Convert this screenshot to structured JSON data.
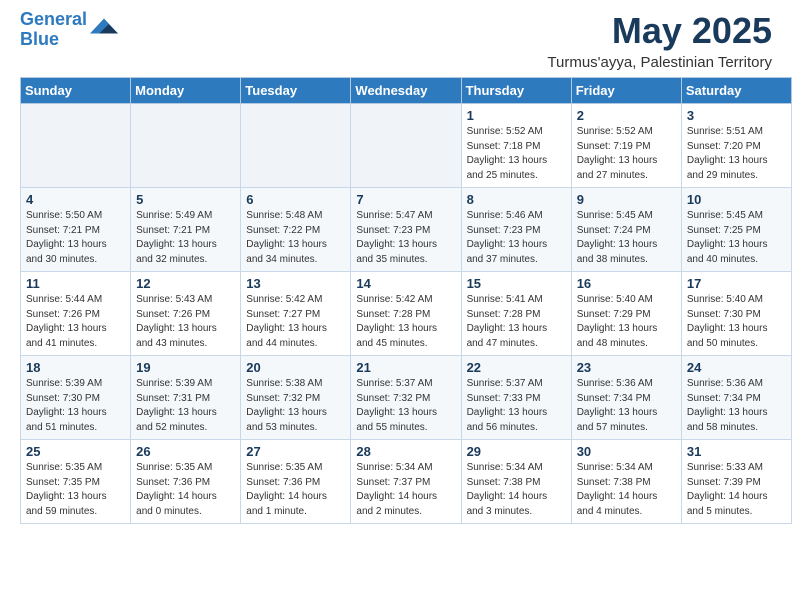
{
  "header": {
    "logo_line1": "General",
    "logo_line2": "Blue",
    "month_title": "May 2025",
    "location": "Turmus'ayya, Palestinian Territory"
  },
  "calendar": {
    "days_of_week": [
      "Sunday",
      "Monday",
      "Tuesday",
      "Wednesday",
      "Thursday",
      "Friday",
      "Saturday"
    ],
    "weeks": [
      [
        {
          "day": "",
          "info": ""
        },
        {
          "day": "",
          "info": ""
        },
        {
          "day": "",
          "info": ""
        },
        {
          "day": "",
          "info": ""
        },
        {
          "day": "1",
          "info": "Sunrise: 5:52 AM\nSunset: 7:18 PM\nDaylight: 13 hours\nand 25 minutes."
        },
        {
          "day": "2",
          "info": "Sunrise: 5:52 AM\nSunset: 7:19 PM\nDaylight: 13 hours\nand 27 minutes."
        },
        {
          "day": "3",
          "info": "Sunrise: 5:51 AM\nSunset: 7:20 PM\nDaylight: 13 hours\nand 29 minutes."
        }
      ],
      [
        {
          "day": "4",
          "info": "Sunrise: 5:50 AM\nSunset: 7:21 PM\nDaylight: 13 hours\nand 30 minutes."
        },
        {
          "day": "5",
          "info": "Sunrise: 5:49 AM\nSunset: 7:21 PM\nDaylight: 13 hours\nand 32 minutes."
        },
        {
          "day": "6",
          "info": "Sunrise: 5:48 AM\nSunset: 7:22 PM\nDaylight: 13 hours\nand 34 minutes."
        },
        {
          "day": "7",
          "info": "Sunrise: 5:47 AM\nSunset: 7:23 PM\nDaylight: 13 hours\nand 35 minutes."
        },
        {
          "day": "8",
          "info": "Sunrise: 5:46 AM\nSunset: 7:23 PM\nDaylight: 13 hours\nand 37 minutes."
        },
        {
          "day": "9",
          "info": "Sunrise: 5:45 AM\nSunset: 7:24 PM\nDaylight: 13 hours\nand 38 minutes."
        },
        {
          "day": "10",
          "info": "Sunrise: 5:45 AM\nSunset: 7:25 PM\nDaylight: 13 hours\nand 40 minutes."
        }
      ],
      [
        {
          "day": "11",
          "info": "Sunrise: 5:44 AM\nSunset: 7:26 PM\nDaylight: 13 hours\nand 41 minutes."
        },
        {
          "day": "12",
          "info": "Sunrise: 5:43 AM\nSunset: 7:26 PM\nDaylight: 13 hours\nand 43 minutes."
        },
        {
          "day": "13",
          "info": "Sunrise: 5:42 AM\nSunset: 7:27 PM\nDaylight: 13 hours\nand 44 minutes."
        },
        {
          "day": "14",
          "info": "Sunrise: 5:42 AM\nSunset: 7:28 PM\nDaylight: 13 hours\nand 45 minutes."
        },
        {
          "day": "15",
          "info": "Sunrise: 5:41 AM\nSunset: 7:28 PM\nDaylight: 13 hours\nand 47 minutes."
        },
        {
          "day": "16",
          "info": "Sunrise: 5:40 AM\nSunset: 7:29 PM\nDaylight: 13 hours\nand 48 minutes."
        },
        {
          "day": "17",
          "info": "Sunrise: 5:40 AM\nSunset: 7:30 PM\nDaylight: 13 hours\nand 50 minutes."
        }
      ],
      [
        {
          "day": "18",
          "info": "Sunrise: 5:39 AM\nSunset: 7:30 PM\nDaylight: 13 hours\nand 51 minutes."
        },
        {
          "day": "19",
          "info": "Sunrise: 5:39 AM\nSunset: 7:31 PM\nDaylight: 13 hours\nand 52 minutes."
        },
        {
          "day": "20",
          "info": "Sunrise: 5:38 AM\nSunset: 7:32 PM\nDaylight: 13 hours\nand 53 minutes."
        },
        {
          "day": "21",
          "info": "Sunrise: 5:37 AM\nSunset: 7:32 PM\nDaylight: 13 hours\nand 55 minutes."
        },
        {
          "day": "22",
          "info": "Sunrise: 5:37 AM\nSunset: 7:33 PM\nDaylight: 13 hours\nand 56 minutes."
        },
        {
          "day": "23",
          "info": "Sunrise: 5:36 AM\nSunset: 7:34 PM\nDaylight: 13 hours\nand 57 minutes."
        },
        {
          "day": "24",
          "info": "Sunrise: 5:36 AM\nSunset: 7:34 PM\nDaylight: 13 hours\nand 58 minutes."
        }
      ],
      [
        {
          "day": "25",
          "info": "Sunrise: 5:35 AM\nSunset: 7:35 PM\nDaylight: 13 hours\nand 59 minutes."
        },
        {
          "day": "26",
          "info": "Sunrise: 5:35 AM\nSunset: 7:36 PM\nDaylight: 14 hours\nand 0 minutes."
        },
        {
          "day": "27",
          "info": "Sunrise: 5:35 AM\nSunset: 7:36 PM\nDaylight: 14 hours\nand 1 minute."
        },
        {
          "day": "28",
          "info": "Sunrise: 5:34 AM\nSunset: 7:37 PM\nDaylight: 14 hours\nand 2 minutes."
        },
        {
          "day": "29",
          "info": "Sunrise: 5:34 AM\nSunset: 7:38 PM\nDaylight: 14 hours\nand 3 minutes."
        },
        {
          "day": "30",
          "info": "Sunrise: 5:34 AM\nSunset: 7:38 PM\nDaylight: 14 hours\nand 4 minutes."
        },
        {
          "day": "31",
          "info": "Sunrise: 5:33 AM\nSunset: 7:39 PM\nDaylight: 14 hours\nand 5 minutes."
        }
      ]
    ]
  }
}
